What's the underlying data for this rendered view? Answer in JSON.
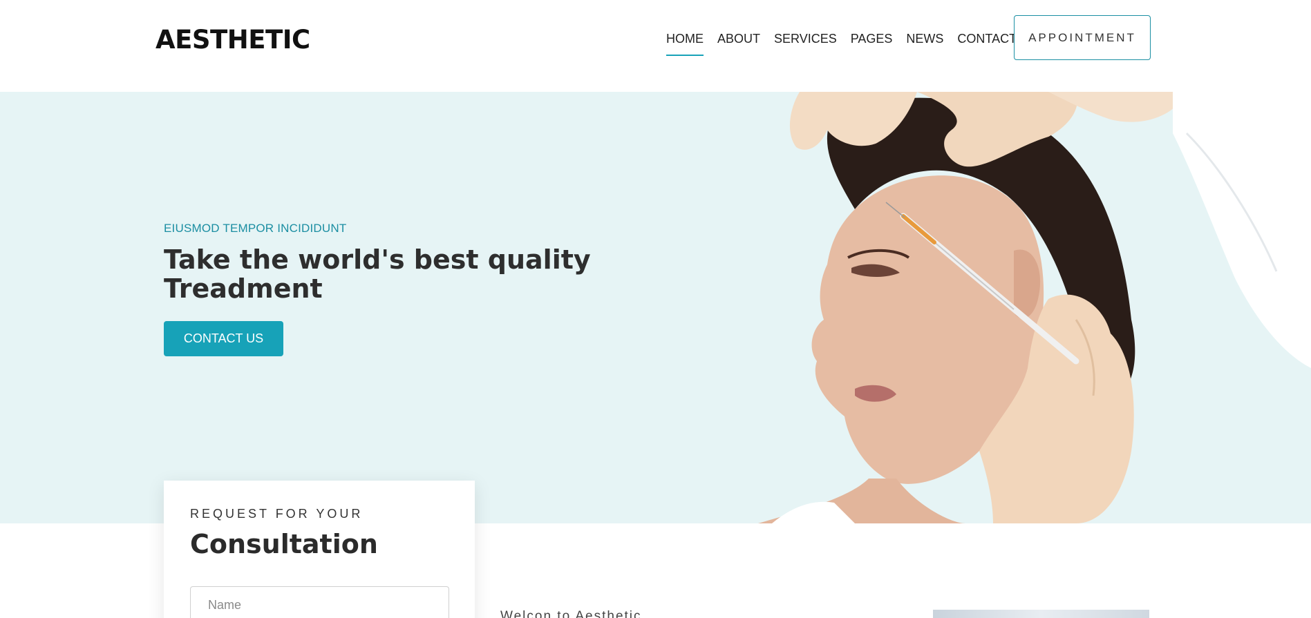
{
  "header": {
    "logo": "AESTHETIC",
    "nav": [
      "HOME",
      "ABOUT",
      "SERVICES",
      "PAGES",
      "NEWS",
      "CONTACT"
    ],
    "active_nav": "HOME",
    "appointment_label": "APPOINTMENT"
  },
  "hero": {
    "subtitle": "EIUSMOD TEMPOR INCIDIDUNT",
    "title": "Take the world's best quality Treadment",
    "cta_label": "CONTACT US",
    "image_alt": "woman receiving cosmetic injection"
  },
  "consultation": {
    "kicker": "REQUEST FOR YOUR",
    "title": "Consultation",
    "name_placeholder": "Name"
  },
  "about": {
    "welcome": "Welcon to Aesthetic"
  },
  "colors": {
    "accent": "#17a2b8",
    "hero_bg": "#e6f4f5",
    "text_dark": "#2e2e2e"
  }
}
